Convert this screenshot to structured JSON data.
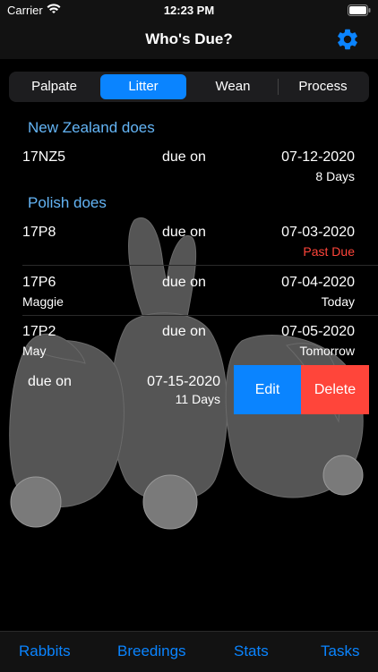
{
  "status_bar": {
    "carrier": "Carrier",
    "time": "12:23 PM"
  },
  "nav": {
    "title": "Who's Due?",
    "settings_icon": "gear-icon"
  },
  "segments": [
    {
      "label": "Palpate",
      "selected": false
    },
    {
      "label": "Litter",
      "selected": true
    },
    {
      "label": "Wean",
      "selected": false
    },
    {
      "label": "Process",
      "selected": false
    }
  ],
  "sections": [
    {
      "header": "New Zealand does",
      "rows": [
        {
          "id": "17NZ5",
          "name": "",
          "due_label": "due on",
          "date": "07-12-2020",
          "status": "8 Days",
          "status_color": "#ffffff"
        }
      ]
    },
    {
      "header": "Polish does",
      "rows": [
        {
          "id": "17P8",
          "name": "",
          "due_label": "due on",
          "date": "07-03-2020",
          "status": "Past Due",
          "status_color": "#ff453a"
        },
        {
          "id": "17P6",
          "name": "Maggie",
          "due_label": "due on",
          "date": "07-04-2020",
          "status": "Today",
          "status_color": "#ffffff"
        },
        {
          "id": "17P2",
          "name": "May",
          "due_label": "due on",
          "date": "07-05-2020",
          "status": "Tomorrow",
          "status_color": "#ffffff"
        }
      ]
    }
  ],
  "swiped_row": {
    "due_label": "due on",
    "date": "07-15-2020",
    "status": "11 Days",
    "edit_label": "Edit",
    "delete_label": "Delete"
  },
  "tabs": [
    {
      "label": "Rabbits"
    },
    {
      "label": "Breedings"
    },
    {
      "label": "Stats"
    },
    {
      "label": "Tasks"
    }
  ],
  "colors": {
    "accent": "#0a84ff",
    "section_header": "#64b5f6",
    "destructive": "#ff453a",
    "background": "#000000",
    "bunny_silhouette": "#555555"
  }
}
